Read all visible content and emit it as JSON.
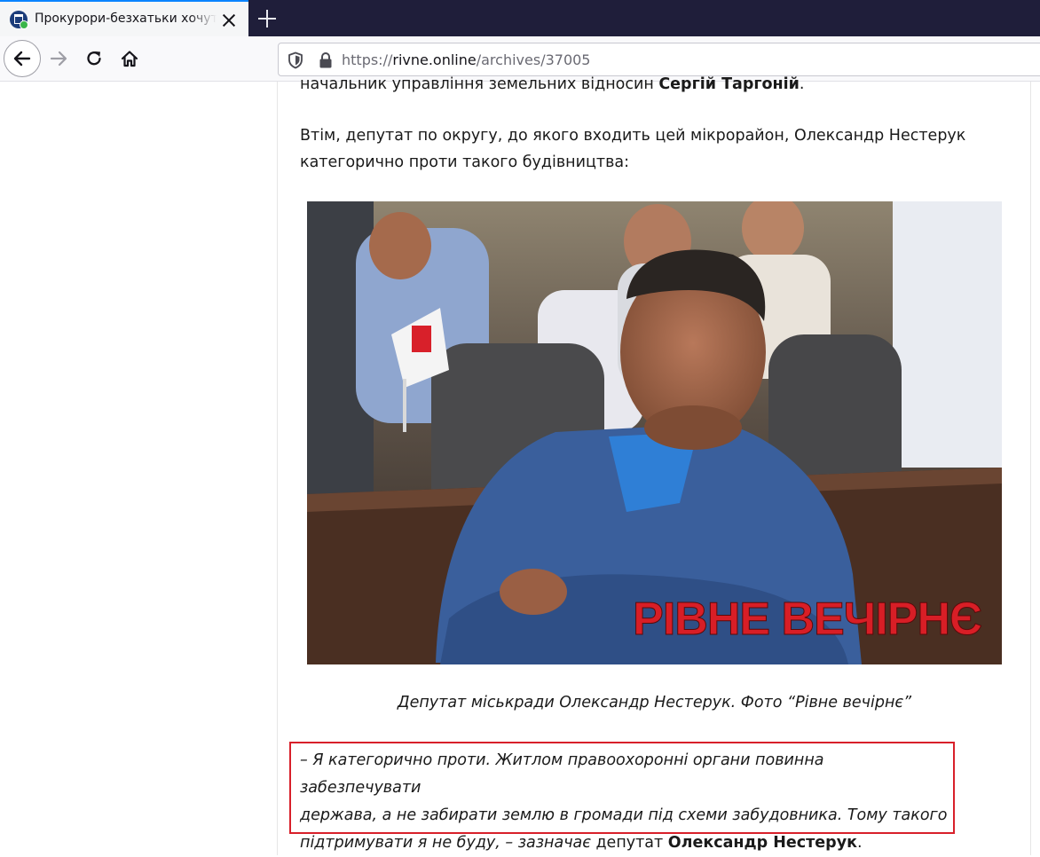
{
  "browser": {
    "tab_title": "Прокурори-безхатьки хочуть",
    "url_scheme": "https://",
    "url_domain": "rivne.online",
    "url_path": "/archives/37005"
  },
  "article": {
    "top_text_pre": "начальник управління земельних відносин ",
    "top_text_bold": "Сергій Таргоній",
    "top_text_post": ".",
    "intro_line1": "Втім, депутат по округу, до якого входить цей мікрорайон, Олександр Нестерук",
    "intro_line2": "категорично проти такого будівництва:",
    "photo_watermark": "РІВНЕ ВЕЧІРНЄ",
    "caption": "Депутат міськради Олександр Нестерук. Фото “Рівне вечірнє”",
    "quote_line1": "– Я категорично проти. Житлом правоохоронні органи повинна забезпечувати",
    "quote_line2": "держава, а не забирати землю в громади під схеми забудовника. Тому такого",
    "quote_line3_italic": "підтримувати я не буду, – зазначає",
    "quote_line3_plain": " депутат ",
    "quote_line3_bold": "Олександр Нестерук",
    "quote_line3_end": "."
  },
  "colors": {
    "tab_strip": "#1f1e3a",
    "accent": "#0a84ff",
    "quote_border": "#d8202a",
    "watermark": "#d81e26"
  },
  "icons": [
    "site-favicon",
    "close-icon",
    "plus-icon",
    "arrow-left-icon",
    "arrow-right-icon",
    "reload-icon",
    "home-icon",
    "shield-icon",
    "lock-icon"
  ]
}
